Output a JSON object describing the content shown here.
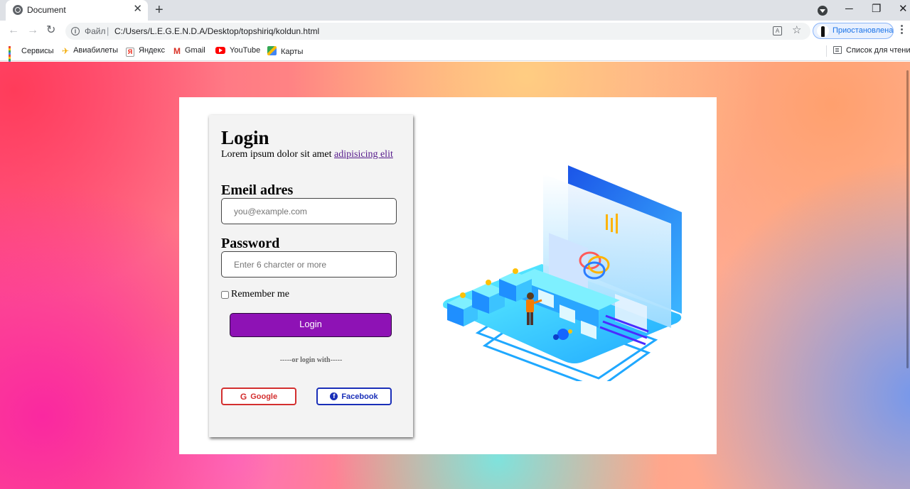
{
  "browser": {
    "tab_title": "Document",
    "address": {
      "scheme_label": "Файл",
      "url": "C:/Users/L.E.G.E.N.D.A/Desktop/topshiriq/koldun.html"
    },
    "profile_label": "Приостановлена",
    "bookmarks": [
      {
        "label": "Сервисы",
        "icon": "apps-icon"
      },
      {
        "label": "Авиабилеты",
        "icon": "plane-icon"
      },
      {
        "label": "Яндекс",
        "icon": "yandex-icon"
      },
      {
        "label": "Gmail",
        "icon": "gmail-icon"
      },
      {
        "label": "YouTube",
        "icon": "youtube-icon"
      },
      {
        "label": "Карты",
        "icon": "maps-icon"
      }
    ],
    "reading_list_label": "Список для чтения"
  },
  "login": {
    "title": "Login",
    "subtitle_text": "Lorem ipsum dolor sit amet",
    "subtitle_link": "adipisicing elit",
    "email": {
      "label": "Emeil adres",
      "placeholder": "you@example.com",
      "value": ""
    },
    "password": {
      "label": "Password",
      "placeholder": "Enter 6 charcter or more",
      "value": ""
    },
    "remember_label": "Remember me",
    "remember_checked": false,
    "submit_label": "Login",
    "divider_text": "-----or login with-----",
    "google_label": "Google",
    "facebook_label": "Facebook"
  },
  "colors": {
    "login_button": "#8e12b5",
    "google": "#d32f2f",
    "facebook": "#1a2fb8",
    "link": "#551a8b"
  }
}
